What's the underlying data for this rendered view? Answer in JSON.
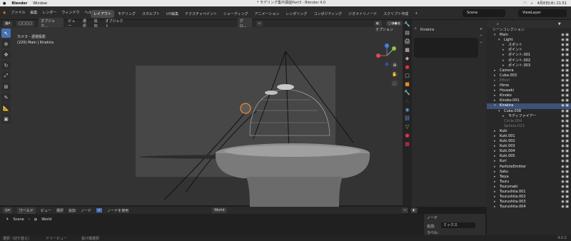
{
  "mac": {
    "app": "Blender",
    "menu": [
      "Window"
    ],
    "title": "* モデリング集中講座Part3 - Blender 4.0",
    "date": "4月8日(木) 21:51"
  },
  "menu": [
    "ファイル",
    "編集",
    "レンダー",
    "ウィンドウ",
    "ヘルプ"
  ],
  "workspaces": [
    "レイアウト",
    "モデリング",
    "スカルプト",
    "UV編集",
    "テクスチャペイント",
    "シェーディング",
    "アニメーション",
    "レンダリング",
    "コンポジティング",
    "ジオメトリノード",
    "スクリプト作成"
  ],
  "scene": "Scene",
  "viewlayer": "ViewLayer",
  "viewport_header": {
    "mode": "オブジェク...",
    "items": [
      "ビュー",
      "選択",
      "追加",
      "オブジェクト"
    ],
    "orient": "グロ..."
  },
  "viewport": {
    "cam_line1": "カメラ - 透視投影",
    "cam_line2": "(220) Main | Kirakira",
    "options": "オプション"
  },
  "props": {
    "object": "Kirakira"
  },
  "outliner": {
    "title": "シーンコレクション"
  },
  "rows": [
    {
      "name": "Main",
      "indent": 1,
      "icon": "▾",
      "color": "#e7e7e7"
    },
    {
      "name": "Light",
      "indent": 2,
      "icon": "▾",
      "color": "#e7e7e7"
    },
    {
      "name": "スポット",
      "indent": 3,
      "icon": "▸",
      "color": "#e7e7e7"
    },
    {
      "name": "ポイント",
      "indent": 3,
      "icon": "▸",
      "color": "#e7e7e7"
    },
    {
      "name": "ポイント.001",
      "indent": 3,
      "icon": "▸",
      "color": "#e7e7e7"
    },
    {
      "name": "ポイント.002",
      "indent": 3,
      "icon": "▸",
      "color": "#e7e7e7"
    },
    {
      "name": "ポイント.003",
      "indent": 3,
      "icon": "▸",
      "color": "#e7e7e7"
    },
    {
      "name": "Camera",
      "indent": 1,
      "icon": "▸",
      "color": "#e7e7e7"
    },
    {
      "name": "Cube.003",
      "indent": 1,
      "icon": "▸",
      "color": "#e7e7e7"
    },
    {
      "name": "Effect",
      "indent": 1,
      "icon": "▸",
      "color": "#7a7a7a"
    },
    {
      "name": "Hime",
      "indent": 1,
      "icon": "▸",
      "color": "#e7e7e7"
    },
    {
      "name": "Houseki",
      "indent": 1,
      "icon": "▸",
      "color": "#e7e7e7"
    },
    {
      "name": "Kinoko",
      "indent": 1,
      "icon": "▸",
      "color": "#e7e7e7"
    },
    {
      "name": "Kinoko.001",
      "indent": 1,
      "icon": "▸",
      "color": "#e7e7e7"
    },
    {
      "name": "Kirakira",
      "indent": 1,
      "icon": "▾",
      "color": "#ffffff",
      "sel": true
    },
    {
      "name": "Cube.038",
      "indent": 2,
      "icon": "▾",
      "color": "#e7e7e7"
    },
    {
      "name": "モディファイアー",
      "indent": 3,
      "icon": "▸",
      "color": "#e7e7e7"
    },
    {
      "name": "Circle.004",
      "indent": 2,
      "icon": "",
      "color": "#7a7a7a"
    },
    {
      "name": "Sphere.013",
      "indent": 2,
      "icon": "",
      "color": "#7a7a7a"
    },
    {
      "name": "Kuki",
      "indent": 1,
      "icon": "▸",
      "color": "#e7e7e7"
    },
    {
      "name": "Kuki.001",
      "indent": 1,
      "icon": "▸",
      "color": "#e7e7e7"
    },
    {
      "name": "Kuki.002",
      "indent": 1,
      "icon": "▸",
      "color": "#e7e7e7"
    },
    {
      "name": "Kuki.003",
      "indent": 1,
      "icon": "▸",
      "color": "#e7e7e7"
    },
    {
      "name": "Kuki.004",
      "indent": 1,
      "icon": "▸",
      "color": "#e7e7e7"
    },
    {
      "name": "Kuki.005",
      "indent": 1,
      "icon": "▸",
      "color": "#e7e7e7"
    },
    {
      "name": "Kuri",
      "indent": 1,
      "icon": "▸",
      "color": "#e7e7e7"
    },
    {
      "name": "ParticleEmitter",
      "indent": 1,
      "icon": "▸",
      "color": "#e7e7e7"
    },
    {
      "name": "Saku",
      "indent": 1,
      "icon": "▸",
      "color": "#e7e7e7"
    },
    {
      "name": "Taiya",
      "indent": 1,
      "icon": "▸",
      "color": "#e7e7e7"
    },
    {
      "name": "Tsuru",
      "indent": 1,
      "icon": "▸",
      "color": "#e7e7e7"
    },
    {
      "name": "Tsurumaki",
      "indent": 1,
      "icon": "▸",
      "color": "#e7e7e7"
    },
    {
      "name": "Tsurushita.001",
      "indent": 1,
      "icon": "▸",
      "color": "#e7e7e7"
    },
    {
      "name": "Tsurushita.002",
      "indent": 1,
      "icon": "▸",
      "color": "#e7e7e7"
    },
    {
      "name": "Tsurushita.003",
      "indent": 1,
      "icon": "▸",
      "color": "#e7e7e7"
    },
    {
      "name": "Tsurushita.004",
      "indent": 1,
      "icon": "▸",
      "color": "#e7e7e7"
    }
  ],
  "node": {
    "editor": "ワールド",
    "items": [
      "ビュー",
      "選択",
      "追加",
      "ノード"
    ],
    "use_nodes": "ノードを使用",
    "world": "World",
    "crumb_scene": "Scene",
    "crumb_world": "World"
  },
  "node_panel": {
    "title": "ノード",
    "name_label": "名前:",
    "name_value": "ミックス",
    "label_label": "ラベル:"
  },
  "status": [
    "選択（切り替え）",
    "ドリービュー",
    "投げ縄選択"
  ],
  "version": "4.0.2"
}
